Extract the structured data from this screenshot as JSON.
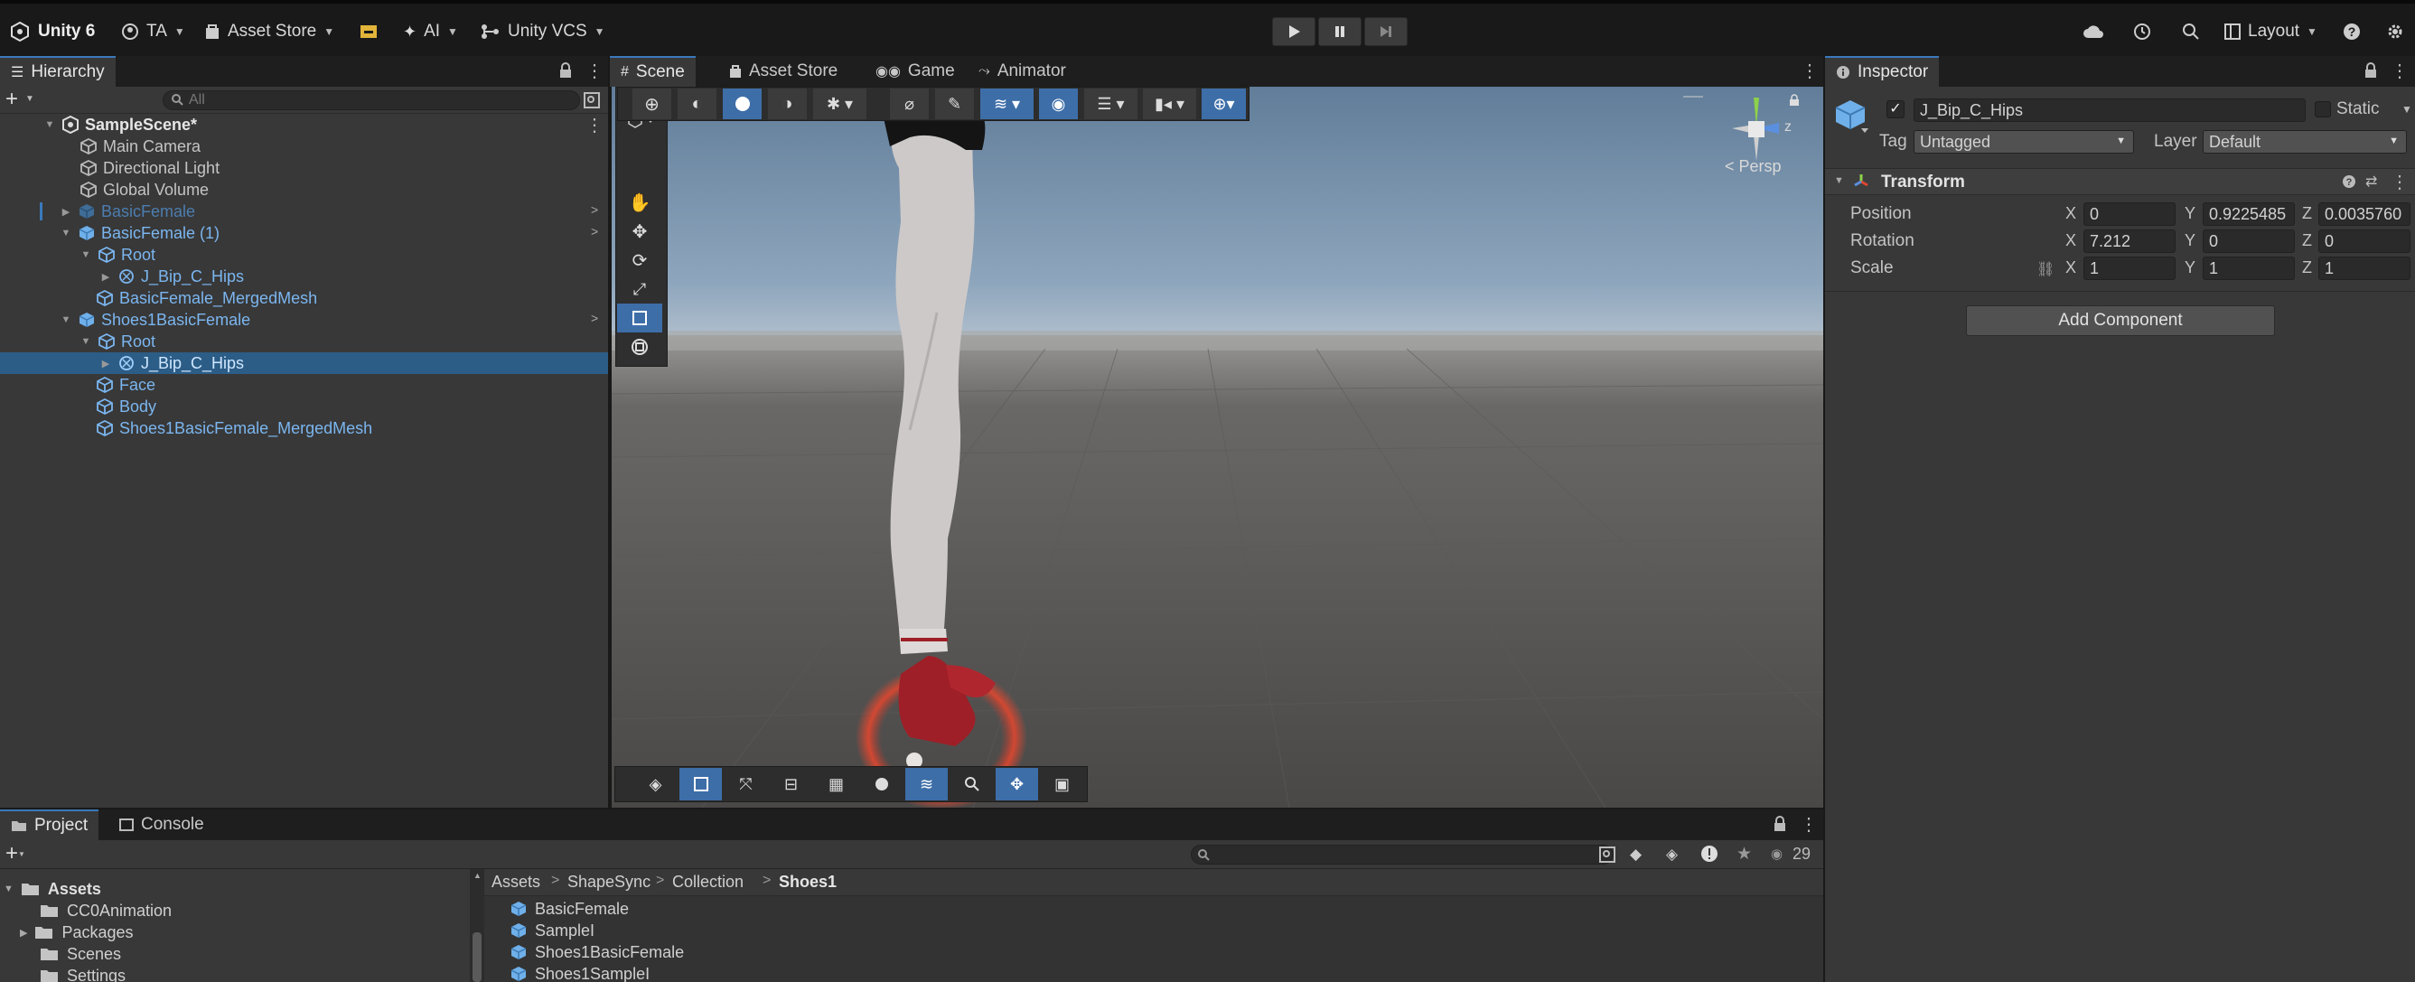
{
  "topbar": {
    "app_title": "Unity 6",
    "account": "TA",
    "asset_store": "Asset Store",
    "ai": "AI",
    "vcs": "Unity VCS",
    "layout": "Layout"
  },
  "hierarchy": {
    "tab_label": "Hierarchy",
    "search_placeholder": "All",
    "rows": [
      {
        "label": "SampleScene*"
      },
      {
        "label": "Main Camera"
      },
      {
        "label": "Directional Light"
      },
      {
        "label": "Global Volume"
      },
      {
        "label": "BasicFemale"
      },
      {
        "label": "BasicFemale (1)"
      },
      {
        "label": "Root"
      },
      {
        "label": "J_Bip_C_Hips"
      },
      {
        "label": "BasicFemale_MergedMesh"
      },
      {
        "label": "Shoes1BasicFemale"
      },
      {
        "label": "Root"
      },
      {
        "label": "J_Bip_C_Hips"
      },
      {
        "label": "Face"
      },
      {
        "label": "Body"
      },
      {
        "label": "Shoes1BasicFemale_MergedMesh"
      }
    ]
  },
  "scene_tabs": {
    "scene": "Scene",
    "asset_store": "Asset Store",
    "game": "Game",
    "animator": "Animator"
  },
  "scene_view": {
    "persp_label": "< Persp",
    "gizmo_axis_label": "z"
  },
  "inspector": {
    "tab_label": "Inspector",
    "object_name": "J_Bip_C_Hips",
    "static_label": "Static",
    "tag_label": "Tag",
    "tag_value": "Untagged",
    "layer_label": "Layer",
    "layer_value": "Default",
    "component_title": "Transform",
    "position_label": "Position",
    "rotation_label": "Rotation",
    "scale_label": "Scale",
    "axis_x": "X",
    "axis_y": "Y",
    "axis_z": "Z",
    "position": {
      "x": "0",
      "y": "0.9225485",
      "z": "0.0035760"
    },
    "rotation": {
      "x": "7.212",
      "y": "0",
      "z": "0"
    },
    "scale": {
      "x": "1",
      "y": "1",
      "z": "1"
    },
    "add_component": "Add Component"
  },
  "project": {
    "tab_project": "Project",
    "tab_console": "Console",
    "hidden_count": "29",
    "tree": [
      {
        "label": "Assets"
      },
      {
        "label": "CC0Animation"
      },
      {
        "label": "Packages"
      },
      {
        "label": "Scenes"
      },
      {
        "label": "Settings"
      }
    ],
    "breadcrumb": [
      {
        "label": "Assets"
      },
      {
        "label": "ShapeSync"
      },
      {
        "label": "Collection"
      },
      {
        "label": "Shoes1"
      }
    ],
    "items": [
      {
        "label": "BasicFemale"
      },
      {
        "label": "SampleI"
      },
      {
        "label": "Shoes1BasicFemale"
      },
      {
        "label": "Shoes1SampleI"
      }
    ]
  },
  "colors": {
    "selection": "#2c5d87",
    "accent": "#3d6ea8",
    "prefab_blue": "#7bb6f0",
    "panel": "#383838",
    "toolbar": "#191919"
  }
}
